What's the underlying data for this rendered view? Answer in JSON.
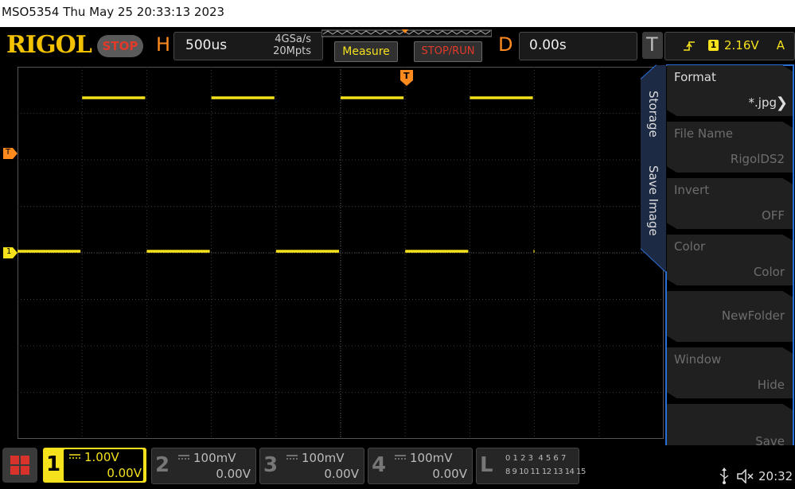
{
  "title_bar": {
    "text": "MSO5354  Thu May 25 20:33:13 2023"
  },
  "toolbar": {
    "logo": "RIGOL",
    "run_state": "STOP",
    "horizontal": {
      "letter": "H",
      "timebase": "500us",
      "sample_rate": "4GSa/s",
      "memory_depth": "20Mpts"
    },
    "measure_label": "Measure",
    "stop_run_label": "STOP/RUN",
    "delay": {
      "letter": "D",
      "value": "0.00s"
    },
    "trigger": {
      "letter": "T",
      "channel": "1",
      "level": "2.16V",
      "mode": "A"
    }
  },
  "markers": {
    "trigger_top": "T",
    "trigger_level": "T",
    "ch1_ground": "1"
  },
  "side_menu": {
    "tabs": [
      "Storage",
      "Save Image"
    ],
    "items": [
      {
        "label": "Format",
        "value": "*.jpg",
        "enabled": true
      },
      {
        "label": "File Name",
        "value": "RigolDS2",
        "enabled": false
      },
      {
        "label": "Invert",
        "value": "OFF",
        "enabled": false
      },
      {
        "label": "Color",
        "value": "Color",
        "enabled": false
      },
      {
        "label": "",
        "value": "NewFolder",
        "enabled": false
      },
      {
        "label": "Window",
        "value": "Hide",
        "enabled": false
      },
      {
        "label": "",
        "value": "Save",
        "enabled": false
      }
    ]
  },
  "channels": [
    {
      "num": "1",
      "scale": "1.00V",
      "offset": "0.00V",
      "active": true
    },
    {
      "num": "2",
      "scale": "100mV",
      "offset": "0.00V",
      "active": false
    },
    {
      "num": "3",
      "scale": "100mV",
      "offset": "0.00V",
      "active": false
    },
    {
      "num": "4",
      "scale": "100mV",
      "offset": "0.00V",
      "active": false
    }
  ],
  "logic": {
    "letter": "L",
    "row1": "0 1 2 3  4 5 6 7",
    "row2": "8 9 10 11 12 13 14 15"
  },
  "status": {
    "time": "20:32"
  },
  "colors": {
    "ch1": "#f5e11c",
    "accent": "#2a6fd6",
    "logo": "#f2c200",
    "orange": "#ff8a1e"
  },
  "waveform": {
    "high_level_div": 3.3,
    "low_level_div": 0,
    "transitions_div": [
      0,
      1,
      2,
      3,
      4,
      5,
      6,
      7,
      8,
      8.01
    ]
  }
}
